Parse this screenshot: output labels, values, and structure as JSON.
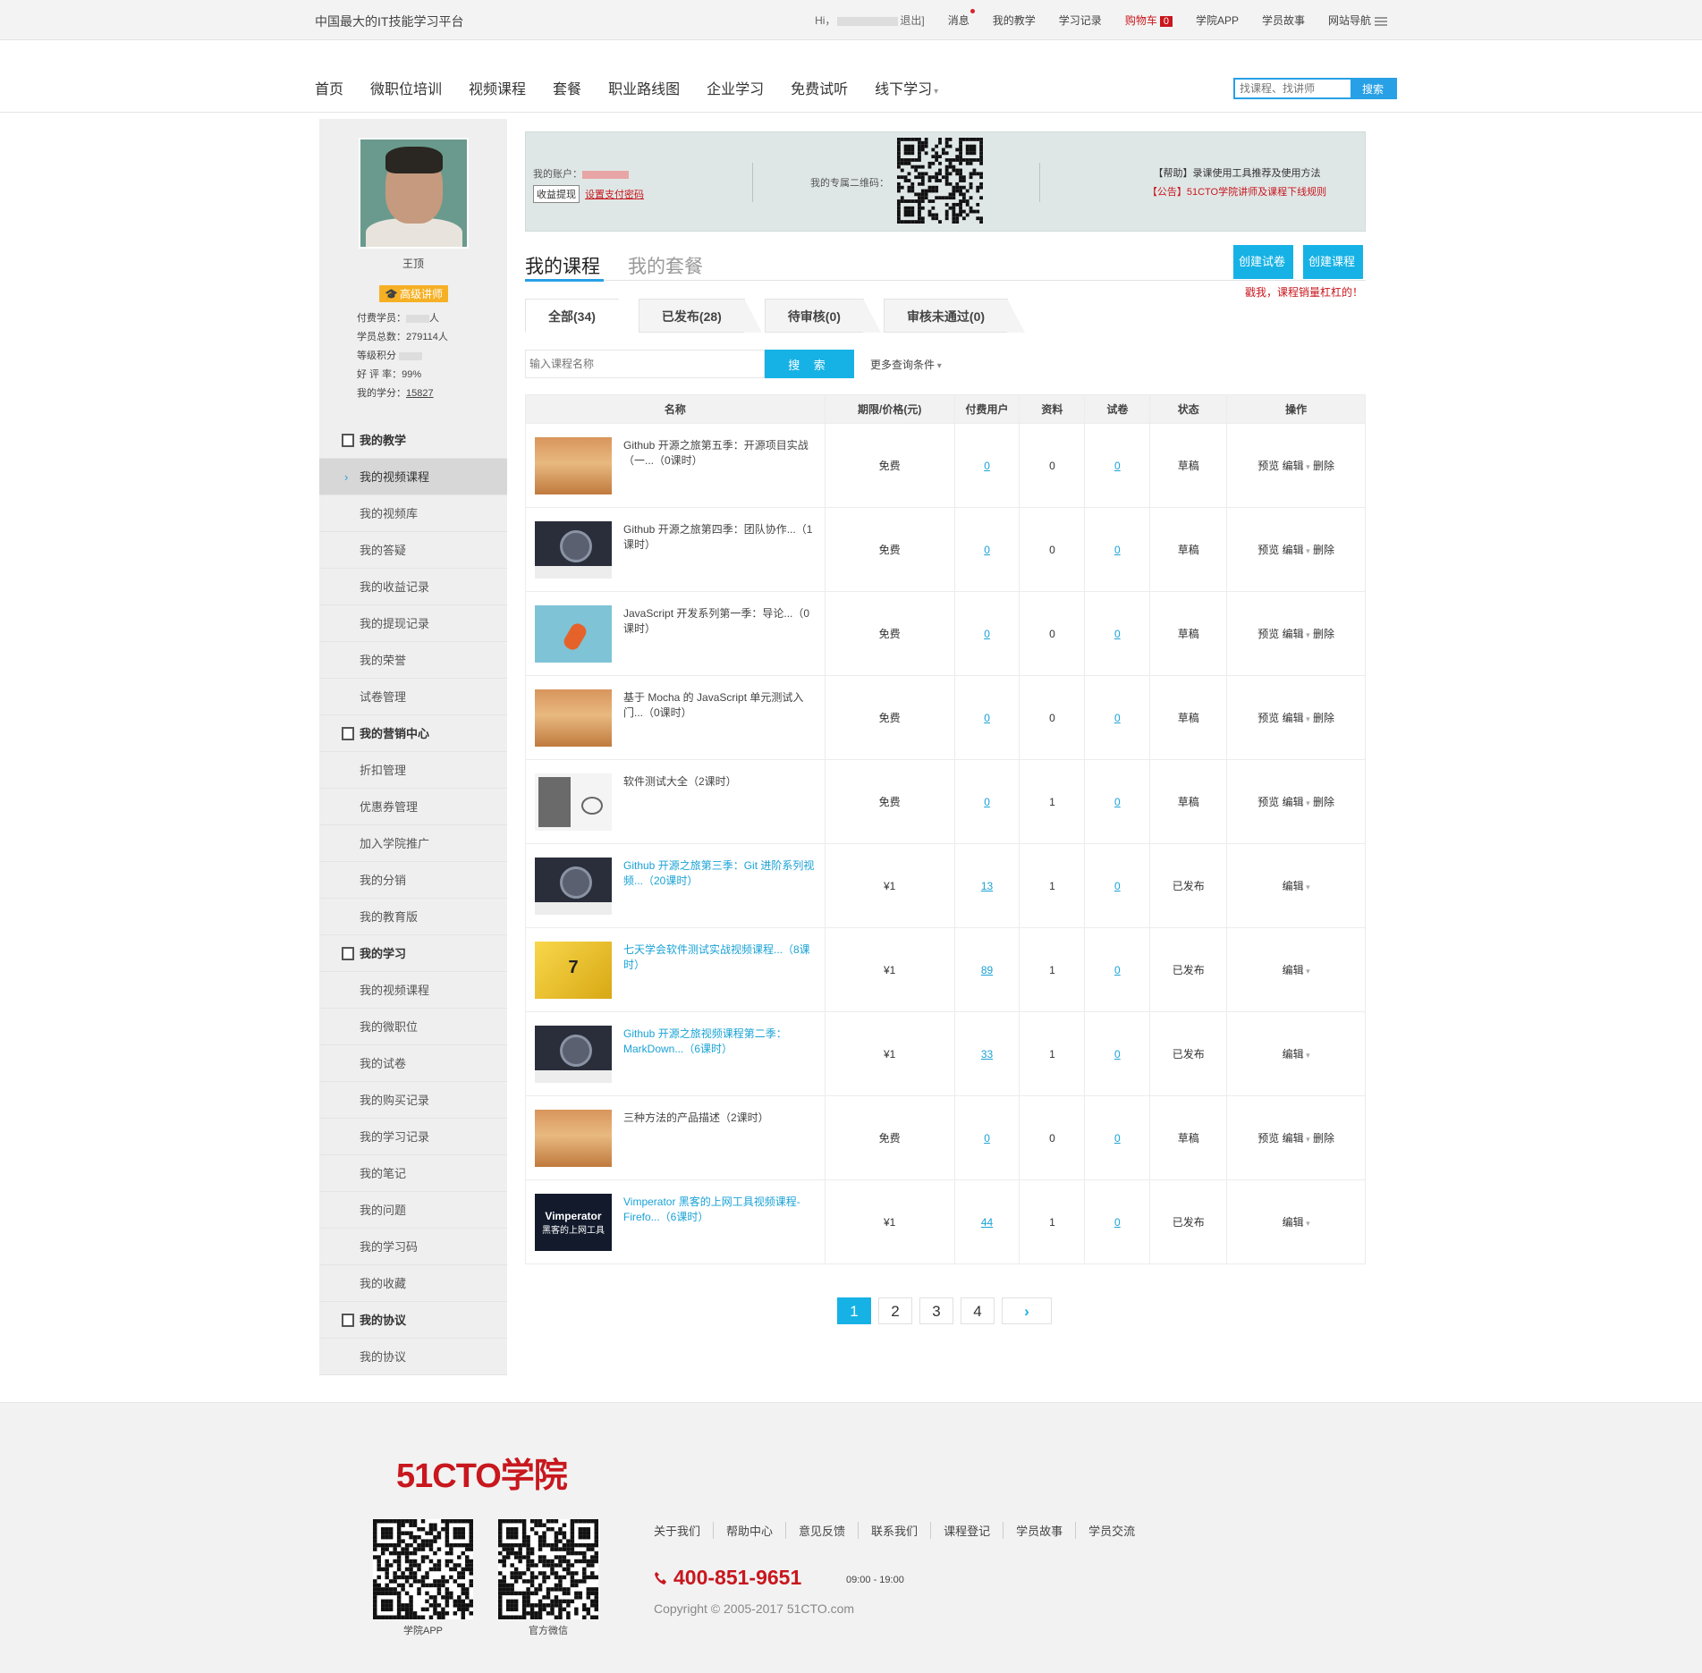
{
  "topbar": {
    "slogan": "中国最大的IT技能学习平台",
    "hi_prefix": "Hi，",
    "logout": "退出]",
    "links": {
      "msg": "消息",
      "teach": "我的教学",
      "learn": "学习记录",
      "cart": "购物车",
      "cart_count": "0",
      "app": "学院APP",
      "story": "学员故事",
      "sitenav": "网站导航"
    }
  },
  "nav": {
    "items": [
      "首页",
      "微职位培训",
      "视频课程",
      "套餐",
      "职业路线图",
      "企业学习",
      "免费试听",
      "线下学习"
    ],
    "search_placeholder": "找课程、找讲师",
    "search_btn": "搜索"
  },
  "profile": {
    "name": "王顶",
    "badge": "高级讲师",
    "paid_label": "付费学员：",
    "paid_suffix": "人",
    "total_label": "学员总数：",
    "total": "279114人",
    "points_label": "等级积分",
    "rating_label": "好 评 率：",
    "rating": "99%",
    "credit_label": "我的学分：",
    "credit": "15827"
  },
  "sidenav": {
    "sec_teach": "我的教学",
    "teach_items": [
      "我的视频课程",
      "我的视频库",
      "我的答疑",
      "我的收益记录",
      "我的提现记录",
      "我的荣誉",
      "试卷管理"
    ],
    "sec_market": "我的营销中心",
    "market_items": [
      "折扣管理",
      "优惠券管理",
      "加入学院推广",
      "我的分销",
      "我的教育版"
    ],
    "sec_learn": "我的学习",
    "learn_items": [
      "我的视频课程",
      "我的微职位",
      "我的试卷",
      "我的购买记录",
      "我的学习记录",
      "我的笔记",
      "我的问题",
      "我的学习码",
      "我的收藏"
    ],
    "sec_proto": "我的协议",
    "proto_items": [
      "我的协议"
    ]
  },
  "info": {
    "account_label": "我的账户：",
    "withdraw": "收益提现",
    "setpwd": "设置支付密码",
    "qr_label": "我的专属二维码：",
    "help": "【帮助】录课使用工具推荐及使用方法",
    "notice": "【公告】51CTO学院讲师及课程下线规则"
  },
  "main": {
    "tab_courses": "我的课程",
    "tab_packages": "我的套餐",
    "btn_exam": "创建试卷",
    "btn_course": "创建课程",
    "tip": "戳我，课程销量杠杠的！",
    "subtabs": [
      "全部(34)",
      "已发布(28)",
      "待审核(0)",
      "审核未通过(0)"
    ],
    "query_placeholder": "输入课程名称",
    "query_btn": "搜 索",
    "more": "更多查询条件"
  },
  "table": {
    "headers": [
      "名称",
      "期限/价格(元)",
      "付费用户",
      "资料",
      "试卷",
      "状态",
      "操作"
    ],
    "rows": [
      {
        "title": "Github 开源之旅第五季：开源项目实战（一...（0课时）",
        "price": "免费",
        "paid": "0",
        "docs": "0",
        "exam": "0",
        "status": "草稿",
        "thumb": "book",
        "pub": false
      },
      {
        "title": "Github 开源之旅第四季：团队协作...（1课时）",
        "price": "免费",
        "paid": "0",
        "docs": "0",
        "exam": "0",
        "status": "草稿",
        "thumb": "gh",
        "pub": false
      },
      {
        "title": "JavaScript 开发系列第一季：导论...（0课时）",
        "price": "免费",
        "paid": "0",
        "docs": "0",
        "exam": "0",
        "status": "草稿",
        "thumb": "js",
        "pub": false
      },
      {
        "title": "基于 Mocha 的 JavaScript 单元测试入门...（0课时）",
        "price": "免费",
        "paid": "0",
        "docs": "0",
        "exam": "0",
        "status": "草稿",
        "thumb": "book",
        "pub": false
      },
      {
        "title": "软件测试大全（2课时）",
        "price": "免费",
        "paid": "0",
        "docs": "1",
        "exam": "0",
        "status": "草稿",
        "thumb": "sw",
        "pub": false
      },
      {
        "title": "Github 开源之旅第三季：Git 进阶系列视频...（20课时）",
        "price": "¥1",
        "paid": "13",
        "docs": "1",
        "exam": "0",
        "status": "已发布",
        "thumb": "gh",
        "pub": true
      },
      {
        "title": "七天学会软件测试实战视频课程...（8课时）",
        "price": "¥1",
        "paid": "89",
        "docs": "1",
        "exam": "0",
        "status": "已发布",
        "thumb": "seven",
        "pub": true
      },
      {
        "title": "Github 开源之旅视频课程第二季：MarkDown...（6课时）",
        "price": "¥1",
        "paid": "33",
        "docs": "1",
        "exam": "0",
        "status": "已发布",
        "thumb": "gh",
        "pub": true
      },
      {
        "title": "三种方法的产品描述（2课时）",
        "price": "免费",
        "paid": "0",
        "docs": "0",
        "exam": "0",
        "status": "草稿",
        "thumb": "book",
        "pub": false
      },
      {
        "title": "Vimperator 黑客的上网工具视频课程-Firefo...（6课时）",
        "price": "¥1",
        "paid": "44",
        "docs": "1",
        "exam": "0",
        "status": "已发布",
        "thumb": "vim",
        "pub": true
      }
    ],
    "op_preview": "预览",
    "op_edit": "编辑",
    "op_delete": "删除"
  },
  "thumb_text": {
    "seven": "7",
    "vim_title": "Vimperator",
    "vim_sub": "黑客的上网工具"
  },
  "pager": {
    "pages": [
      "1",
      "2",
      "3",
      "4"
    ],
    "next": "›"
  },
  "footer": {
    "logo": "51CTO学院",
    "qr1": "学院APP",
    "qr2": "官方微信",
    "links": [
      "关于我们",
      "帮助中心",
      "意见反馈",
      "联系我们",
      "课程登记",
      "学员故事",
      "学员交流"
    ],
    "phone": "400-851-9651",
    "hours": "09:00 - 19:00",
    "copyright": "Copyright © 2005-2017 51CTO.com"
  },
  "colors": {
    "accent": "#17b2e5",
    "brand_red": "#c8171e",
    "badge": "#f6b024"
  }
}
